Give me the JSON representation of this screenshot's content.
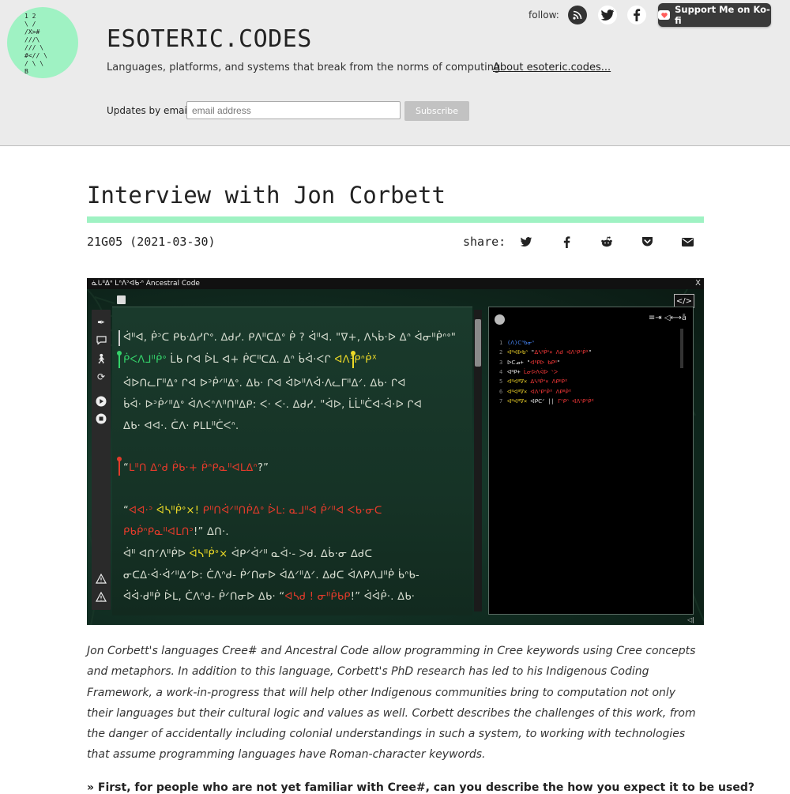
{
  "site": {
    "title": "ESOTERIC.CODES",
    "tagline": "Languages, platforms, and systems that break from the norms of computing",
    "about_link": "About esoteric.codes...",
    "logo_icon": "ascii-art-logo",
    "logo_lines": [
      "1      2",
      "  \\    /",
      "  /X>#",
      "  ///\\",
      "  ///   \\",
      "#<//     \\",
      "  / \\      \\",
      "     B"
    ]
  },
  "follow": {
    "label": "follow:",
    "icons": [
      "rss-icon",
      "twitter-icon",
      "facebook-icon"
    ]
  },
  "kofi": {
    "label": "Support Me on Ko-fi",
    "icon": "kofi-cup-icon"
  },
  "newsletter": {
    "label": "Updates by email:",
    "placeholder": "email address",
    "button": "Subscribe"
  },
  "post": {
    "title": "Interview with Jon Corbett",
    "id_date": "21G05 (2021-03-30)",
    "share_label": "share:",
    "share_icons": [
      "twitter-icon",
      "facebook-icon",
      "reddit-icon",
      "pocket-icon",
      "email-icon"
    ],
    "lead": "Jon Corbett's languages Cree# and Ancestral Code allow programming in Cree keywords using Cree concepts and metaphors. In addition to this language, Corbett's PhD research has led to his Indigenous Coding Framework, a work-in-progress that will help other Indigenous communities bring to computation not only their languages but their cultural logic and values as well. Corbett describes the challenges of this work, from the danger of accidentally including colonial understandings in such a system, to working with technologies that assume programming languages have Roman-character keywords.",
    "question": "» First, for people who are not yet familiar with Cree#, can you describe the how you expect it to be used?"
  },
  "figure": {
    "window_title": "ᓈᒐᐦᐃᐤ ᒪᐢᐱᐣᐊᑲᐧᐢ  Ancestral Code",
    "close": "X",
    "tools": [
      "feather-icon",
      "speech-bubble-icon",
      "walking-person-icon",
      "refresh-icon",
      "play-icon",
      "stop-icon",
      "warning-icon",
      "warning-icon"
    ],
    "code_lines": [
      [
        {
          "t": "ᐋᐦᐊ, ᑮᐣᑕ ᑭᑲᐧᐃᓯᒋᐤ. ᐃᑯᓯ. ᑭᐱᐦᑕᐃᐤ ᑮ ? ᐋᐦᐊ. \"ᐁ+, ᐱᓴᑳ·ᐅ ᐃᐢ ᐋᓂᐦᑮᐢᐤ\"",
          "c": ""
        }
      ],
      [
        {
          "t": "ᑮᐸᐱᒧᐦᑮᐤ",
          "c": "grn"
        },
        {
          "t": " ᒫᑲ ᒋᐊ ᐆᒪ ᐊ+ ᑮᑕᐦᑕᐃ. ᐃᐢ ᑳᐋ·ᐸᒋ ",
          "c": ""
        },
        {
          "t": "ᐊᐱᐣᑭᐢᑮᕽ",
          "c": "yel"
        }
      ],
      [
        {
          "t": "ᐋᐅᑎᓚᒥᐦᐃᐤ ᒋᐊ ᐅᐣᑮᐟᐦᐃᐤ. ᐃᑲ· ᒋᐊ ᐋᐅᐦᐱᐋ·ᐱᓚᒥᐦᐃᐟ. ᐃᑲ· ᒋᐊ",
          "c": ""
        }
      ],
      [
        {
          "t": "ᑳᐋ· ᐅᐣᑮᐟᐦᐃᐤ ᐋᐱᐸᐢᐱᐦᑎᐦᐃᑭ: ᐸ· ᐸ·. ᐃᑯᓯ. \"ᐋᐅ, ᒫᒫᐦᑖᐊ·ᐋ·ᐅ ᒋᐊ",
          "c": ""
        }
      ],
      [
        {
          "t": "ᐃᑲ· ᐊᐊ·. ᑖᐱ· ᑭᒪᒪᐦᑖᐸᐢ.",
          "c": ""
        }
      ],
      [
        {
          "t": "“",
          "c": ""
        },
        {
          "t": "ᒪᐦᑎ ᐃᐢᑯ ᑮᑲ·+ ᑮᐢᑭᓇᐦᐊᒪᐃᐢ",
          "c": "red"
        },
        {
          "t": "?”",
          "c": ""
        }
      ],
      [
        {
          "t": "“",
          "c": ""
        },
        {
          "t": "ᐊᐊ·ᐣ ",
          "c": "red"
        },
        {
          "t": "ᐋᓴᐦᑮᐤ×!",
          "c": "yel"
        },
        {
          "t": " ᑭᐦᑎᐋᐟᐦᑎᑮᐃᐤ ᐆᒪ: ᓇᒧᐦᐊ ᑮᐟᐦᐊ ᐸᑲ·ᓂᑕ",
          "c": "red"
        }
      ],
      [
        {
          "t": "ᑭᑲᑮᐢᑭᓇᐦᐊᒪᑎᐣ",
          "c": "red"
        },
        {
          "t": "!” ᐃᑎ·.",
          "c": ""
        }
      ],
      [
        {
          "t": "ᐋᐦ ᐊᑎᐟᐱᐦᑮᐅ ",
          "c": ""
        },
        {
          "t": "ᐋᓴᐦᑮᐤ×",
          "c": "yel"
        },
        {
          "t": " ᐋᑭᐟᐋᐟᐦ ᓇᐋ·- ᐳᑯ. ᐃᑳ·ᓂ ᐃᑯᑕ",
          "c": ""
        }
      ],
      [
        {
          "t": "ᓂᑕᐃ·ᐋ·ᐋᐟᐦᐃᐟᐅ: ᑖᐱᐢᑯ- ᑮᐟᑎᓂᐅ ᐋᐃᐟᐦᐃᐟ. ᐃᑯᑕ ᐋᐱᑭᐱᒧᐦᑮ ᑳᐢᑲ-",
          "c": ""
        }
      ],
      [
        {
          "t": "ᐋᐋ·ᑯᐦᑮ ᐆᒪ, ᑖᐱᐢᑯ- ᑮᐟᑎᓂᐅ ᐃᑲ· “",
          "c": ""
        },
        {
          "t": "ᐊᓴᑯ ! ᓂᐦᑮᑲᑭ",
          "c": "red"
        },
        {
          "t": "!” ᐋᐋᑮ·. ᐃᑲ·",
          "c": ""
        }
      ]
    ],
    "console_lines": [
      [
        {
          "t": "(ᐱ)ᑕᐢᑲᓂᐢ",
          "c": "b"
        }
      ],
      [
        {
          "t": "ᐋᐦᐊᐅᑲᐢ ",
          "c": "y"
        },
        {
          "t": "\"",
          "c": "w"
        },
        {
          "t": "ᐃᓴᐦᑮᐤ× ᐱᑯ ᐊᐱᐣᑭᐢᑮᕽ",
          "c": "r"
        },
        {
          "t": "\"",
          "c": "w"
        }
      ],
      [
        {
          "t": "ᐅᑕᓄ+ \"",
          "c": "w"
        },
        {
          "t": "ᐊᐦᑭᐅ ᑲᑭᐦ",
          "c": "r"
        },
        {
          "t": "\"",
          "c": "w"
        }
      ],
      [
        {
          "t": "ᐊᐦᑭ+ ",
          "c": "w"
        },
        {
          "t": "ᒫᓂᐅᐱᐋᐅ ᐠᐳ",
          "c": "r"
        }
      ],
      [
        {
          "t": "ᐊᐦᐊᐦᐁ× ",
          "c": "y"
        },
        {
          "t": "ᐃᓴᐦᑮᐤ× ᐱᑭᐦᑮᕽ",
          "c": "r"
        }
      ],
      [
        {
          "t": "ᐊᐦᐊᐦᐁ× ",
          "c": "y"
        },
        {
          "t": "ᐊᐱᐣᑭᐢᑮᕽ ᐱᑭᐦᑮᕽ",
          "c": "r"
        }
      ],
      [
        {
          "t": "ᐊᐦᐊᐦᐁ× ",
          "c": "y"
        },
        {
          "t": "ᐊᑭᑕᐟ || ",
          "c": "w"
        },
        {
          "t": "ᒥᐢᑭᐢ ᐊᐱᐣᑭᐢᑮᕽ",
          "c": "r"
        }
      ]
    ],
    "console_icons": [
      "orb-icon",
      "wrap-icon",
      "direction-icon"
    ],
    "toggle_icon": "code-icon",
    "footer_icon": "volume-icon"
  },
  "colors": {
    "accent": "#9ff2c3",
    "header_bg": "#ebebeb",
    "kofi_bg": "#3a3a3a",
    "code_red": "#e23b2b",
    "code_yellow": "#ecd927",
    "code_green": "#34d26a"
  }
}
